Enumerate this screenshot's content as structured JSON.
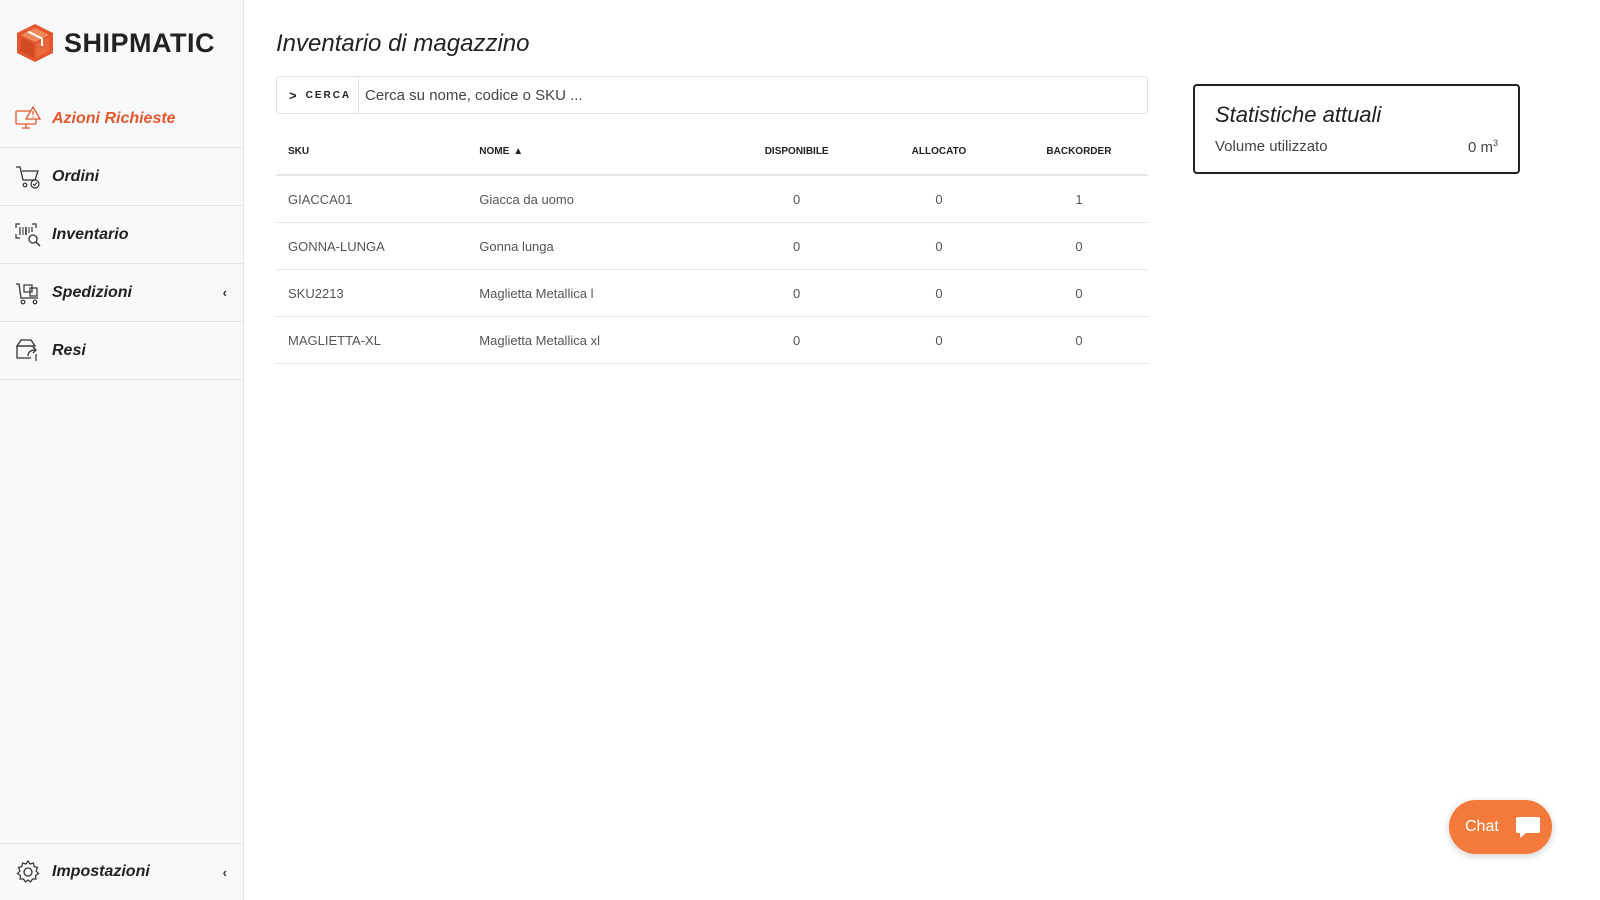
{
  "brand": {
    "name": "SHIPMATIC",
    "accent": "#e4572e"
  },
  "sidebar": {
    "items": [
      {
        "label": "Azioni Richieste",
        "icon": "alert-monitor-icon",
        "active": true
      },
      {
        "label": "Ordini",
        "icon": "cart-icon"
      },
      {
        "label": "Inventario",
        "icon": "barcode-search-icon"
      },
      {
        "label": "Spedizioni",
        "icon": "cart-box-icon",
        "chevron": "‹"
      },
      {
        "label": "Resi",
        "icon": "return-box-icon"
      }
    ],
    "settings": {
      "label": "Impostazioni",
      "icon": "gear-icon",
      "chevron": "‹"
    }
  },
  "main": {
    "title": "Inventario di magazzino",
    "search": {
      "button_label": "CERCA",
      "placeholder": "Cerca su nome, codice o SKU ..."
    },
    "table": {
      "headers": {
        "sku": "SKU",
        "nome": "NOME",
        "disponibile": "DISPONIBILE",
        "allocato": "ALLOCATO",
        "backorder": "BACKORDER"
      },
      "sort": {
        "column": "nome",
        "direction": "ascending"
      },
      "rows": [
        {
          "sku": "GIACCA01",
          "nome": "Giacca da uomo",
          "disponibile": "0",
          "allocato": "0",
          "backorder": "1"
        },
        {
          "sku": "GONNA-LUNGA",
          "nome": "Gonna lunga",
          "disponibile": "0",
          "allocato": "0",
          "backorder": "0"
        },
        {
          "sku": "SKU2213",
          "nome": "Maglietta Metallica l",
          "disponibile": "0",
          "allocato": "0",
          "backorder": "0"
        },
        {
          "sku": "MAGLIETTA-XL",
          "nome": "Maglietta Metallica xl",
          "disponibile": "0",
          "allocato": "0",
          "backorder": "0"
        }
      ]
    }
  },
  "stats": {
    "title": "Statistiche attuali",
    "volume_label": "Volume utilizzato",
    "volume_value": "0 m",
    "volume_unit_exp": "3"
  },
  "chat": {
    "label": "Chat",
    "color": "#f47a3c"
  }
}
